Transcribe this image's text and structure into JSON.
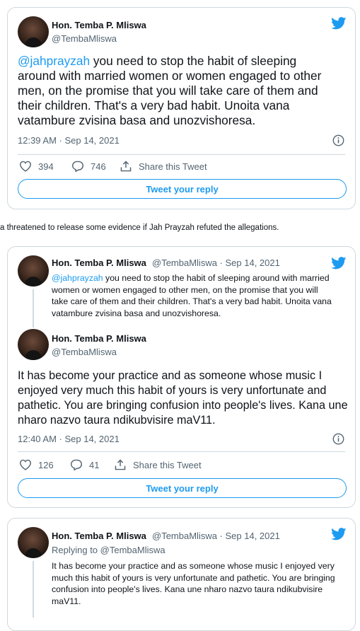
{
  "tweet1": {
    "name": "Hon. Temba P. Mliswa",
    "handle": "@TembaMliswa",
    "mention": "@jahprayzah",
    "text": " you need to stop the habit of sleeping around with married women or women engaged to other men, on the promise that you will take care of them and their children. That's a very bad habit. Unoita vana vatambure zvisina basa and unozvishoresa.",
    "time": "12:39 AM · Sep 14, 2021",
    "likes": "394",
    "replies": "746",
    "share_label": "Share this Tweet",
    "reply_button": "Tweet your reply"
  },
  "caption": "a threatened to release some evidence if Jah Prayzah refuted the allegations.",
  "tweet2": {
    "quoted": {
      "name": "Hon. Temba P. Mliswa",
      "meta": "@TembaMliswa · Sep 14, 2021",
      "mention": "@jahprayzah",
      "text": " you need to stop the habit of sleeping around with married women or women engaged to other men, on the promise that you will take care of them and their children. That's a very bad habit. Unoita vana vatambure zvisina basa and unozvishoresa."
    },
    "name": "Hon. Temba P. Mliswa",
    "handle": "@TembaMliswa",
    "text": "It has become your practice and as someone whose music I enjoyed very much this habit of yours is very unfortunate and pathetic. You are bringing confusion into people's lives. Kana une nharo nazvo taura ndikubvisire maV11.",
    "time": "12:40 AM · Sep 14, 2021",
    "likes": "126",
    "replies": "41",
    "share_label": "Share this Tweet",
    "reply_button": "Tweet your reply"
  },
  "tweet3": {
    "name": "Hon. Temba P. Mliswa",
    "meta": "@TembaMliswa · Sep 14, 2021",
    "replying_to": "Replying to @TembaMliswa",
    "text": "It has become your practice and as someone whose music I enjoyed very much this habit of yours is very unfortunate and pathetic. You are bringing confusion into people's lives. Kana une nharo nazvo taura ndikubvisire maV11."
  },
  "colors": {
    "accent": "#1d9bf0",
    "muted": "#536471",
    "border": "#cfd9de"
  },
  "icons": [
    "twitter-bird-icon",
    "info-icon",
    "heart-icon",
    "reply-icon",
    "share-icon"
  ]
}
